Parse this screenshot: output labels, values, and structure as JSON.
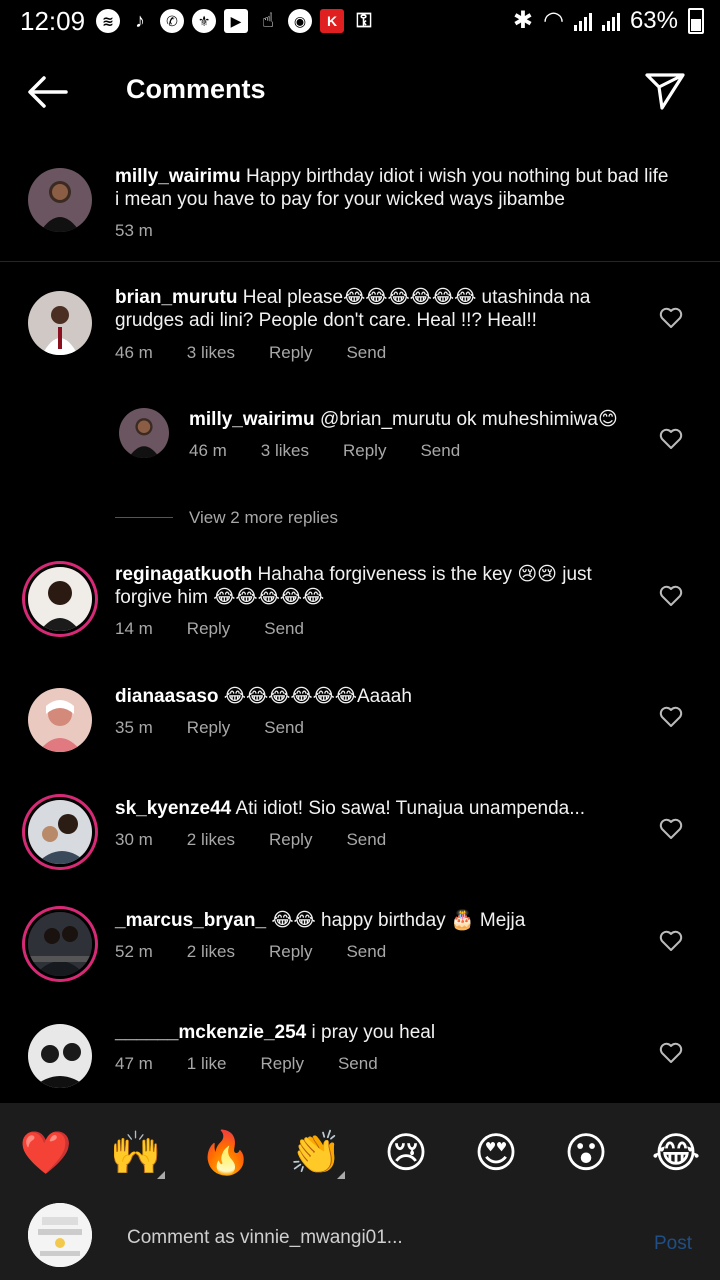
{
  "status_bar": {
    "time": "12:09",
    "battery": "63%",
    "apps": [
      "spotify-icon",
      "tiktok-icon",
      "whatsapp-icon",
      "man-utd-icon",
      "youtube-icon",
      "gesture-icon",
      "chrome-icon",
      "kilimall-icon",
      "key-icon"
    ]
  },
  "header": {
    "title": "Comments"
  },
  "caption": {
    "user": "milly_wairimu",
    "text": "Happy birthday idiot i wish you nothing but bad life i mean you have to pay for your wicked ways jibambe",
    "time": "53 m"
  },
  "comments": [
    {
      "user": "brian_murutu",
      "text": "Heal please😂😂😂😂😂😂 utashinda na grudges adi lini? People don't care. Heal !!? Heal!!",
      "time": "46 m",
      "likes": "3 likes",
      "reply": "Reply",
      "send": "Send"
    },
    {
      "user": "milly_wairimu",
      "text": "@brian_murutu ok muheshimiwa😊",
      "time": "46 m",
      "likes": "3 likes",
      "reply": "Reply",
      "send": "Send"
    },
    {
      "user": "reginagatkuoth",
      "text": "Hahaha forgiveness is the key 😢😢 just forgive him 😂😂😂😂😂",
      "time": "14 m",
      "likes": "",
      "reply": "Reply",
      "send": "Send"
    },
    {
      "user": "dianaasaso",
      "text": "😂😂😂😂😂😂Aaaah",
      "time": "35 m",
      "likes": "",
      "reply": "Reply",
      "send": "Send"
    },
    {
      "user": "sk_kyenze44",
      "text": "Ati idiot! Sio sawa! Tunajua unampenda...",
      "time": "30 m",
      "likes": "2 likes",
      "reply": "Reply",
      "send": "Send"
    },
    {
      "user": "_marcus_bryan_",
      "text": "😂😂 happy birthday 🎂 Mejja",
      "time": "52 m",
      "likes": "2 likes",
      "reply": "Reply",
      "send": "Send"
    },
    {
      "user": "______mckenzie_254",
      "text": "i pray you heal",
      "time": "47 m",
      "likes": "1 like",
      "reply": "Reply",
      "send": "Send"
    }
  ],
  "view_more_replies": "View 2 more replies",
  "reactions": [
    "❤️",
    "🙌",
    "🔥",
    "👏",
    "😢",
    "😍",
    "😮",
    "😂"
  ],
  "composer": {
    "placeholder": "Comment as vinnie_mwangi01...",
    "post": "Post"
  },
  "colors": {
    "background": "#000000",
    "muted": "#a8a8a8",
    "post_disabled": "#1f4f86",
    "story_ring": "#d62976"
  }
}
